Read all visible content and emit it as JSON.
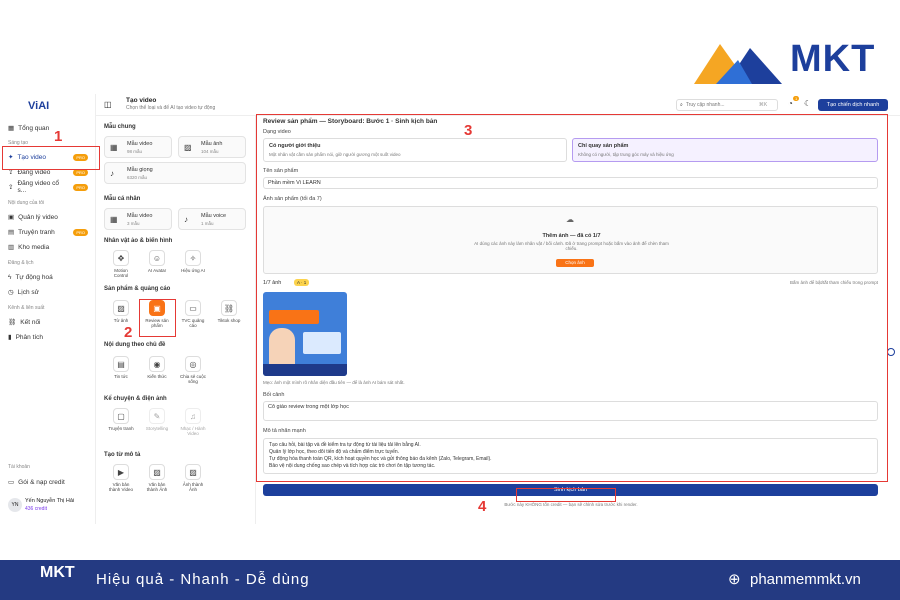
{
  "brand": {
    "name": "MKT"
  },
  "sidebar": {
    "logo": "ViAI",
    "items": [
      {
        "label": "Tổng quan"
      },
      {
        "label": "Tạo video",
        "badge": "PRO"
      },
      {
        "label": "Đăng video",
        "badge": "PRO"
      },
      {
        "label": "Đăng video cổ s...",
        "badge": "PRO"
      },
      {
        "label": "Quản lý video"
      },
      {
        "label": "Truyện tranh",
        "badge": "PRO"
      },
      {
        "label": "Kho media"
      },
      {
        "label": "Tự động hoá"
      },
      {
        "label": "Lịch sử"
      },
      {
        "label": "Kết nối"
      },
      {
        "label": "Phân tích"
      },
      {
        "label": "Gói & nạp credit"
      }
    ],
    "sections": [
      "Sáng tạo",
      "Nội dung của tôi",
      "Đăng & lịch",
      "Kênh & liên suất",
      "Tài khoản"
    ],
    "user": {
      "initials": "YN",
      "name": "Yến Nguyễn Thị Hải",
      "credit": "436 credit"
    }
  },
  "topbar": {
    "title": "Tạo video",
    "subtitle": "Chọn thể loại và để AI tạo video tự động",
    "search_placeholder": "Truy cập nhanh...",
    "search_kbd": "⌘K",
    "notif_count": "1",
    "cta": "Tạo chiến dịch nhanh"
  },
  "templates": {
    "common_title": "Mẫu chung",
    "video": {
      "label": "Mẫu video",
      "count": "98 mẫu"
    },
    "image": {
      "label": "Mẫu ảnh",
      "count": "104 mẫu"
    },
    "voice": {
      "label": "Mẫu giọng",
      "count": "6320 mẫu"
    },
    "personal_title": "Mẫu cá nhân",
    "pvideo": {
      "label": "Mẫu video",
      "count": "3 mẫu"
    },
    "pvoice": {
      "label": "Mẫu voice",
      "count": "1 mẫu"
    },
    "char_title": "Nhân vật ảo & biến hình",
    "char_items": [
      "Motion Control",
      "AI Avatar",
      "Hiệu ứng AI"
    ],
    "product_title": "Sản phẩm & quảng cáo",
    "product_items": [
      "Từ ảnh",
      "Review sản phẩm",
      "TVC quảng cáo",
      "Tiktok shop"
    ],
    "topic_title": "Nội dung theo chủ đề",
    "topic_items": [
      "Tin tức",
      "Kiến thức",
      "Chia sẻ cuộc sống"
    ],
    "story_title": "Kể chuyện & điện ảnh",
    "story_items": [
      "Truyện tranh",
      "Storytelling",
      "Nhạc / Hành Video"
    ],
    "text_title": "Tạo từ mô tả",
    "text_items": [
      "Văn bản thành Video",
      "Văn bản thành Ảnh",
      "Ảnh thành Ảnh"
    ]
  },
  "form": {
    "header": "Review sản phẩm — Storyboard: Bước 1 · Sinh kịch bản",
    "type_label": "Dạng video",
    "opt1_title": "Có người giới thiệu",
    "opt1_desc": "Một nhân vật cầm sản phẩm nói, giữ người gương một suốt video",
    "opt2_title": "Chỉ quay sản phẩm",
    "opt2_desc": "Không có người, tập trung góc máy và hiệu ứng",
    "name_label": "Tên sản phẩm",
    "name_value": "Phần mềm Vi LEARN",
    "img_label": "Ảnh sản phẩm (tối đa 7)",
    "upload_title": "Thêm ảnh — đã có 1/7",
    "upload_desc": "AI dùng các ảnh này làm nhân vật / bối cảnh. Đã ở trang prompt hoặc bấm vào ảnh để chèn tham chiếu.",
    "upload_btn": "Chọn ảnh",
    "img_count": "1/7 ảnh",
    "img_tag": "A · 1",
    "img_hint": "Bấm ảnh để bật/tắt tham chiếu trong prompt",
    "img_caption": "Mẹo: ảnh một mình rõ nhân diện đầu tiên — để là ảnh AI bám sát nhất.",
    "bg_label": "Bối cảnh",
    "bg_value": "Cô giáo review trong một lớp học",
    "desc_label": "Mô tả nhãn mạnh",
    "desc_lines": [
      "Tạo câu hỏi, bài tập và đề kiểm tra tự động từ tài liệu tải lên bằng AI.",
      "Quản lý lớp học, theo dõi tiến độ và chấm điểm trực tuyến.",
      "Tự động hóa thanh toán QR, kích hoạt quyền học và gửi thông báo đa kênh (Zalo, Telegram, Email).",
      "Bảo vệ nội dung chống sao chép và tích hợp các trò chơi ôn tập tương tác."
    ],
    "submit": "Sinh kịch bản",
    "note": "Bước này KHÔNG tốn credit — bạn sẽ chỉnh sửa trước khi render."
  },
  "annotations": [
    "1",
    "2",
    "3",
    "4"
  ],
  "footer": {
    "logo": "MKT",
    "slogan": "Hiệu quả - Nhanh - Dễ dùng",
    "site": "phanmemmkt.vn"
  },
  "colors": {
    "brand_blue": "#1d3f9c",
    "brand_orange": "#f5a623",
    "footer_bg": "#243a82",
    "annotation_red": "#e53935",
    "accent_orange": "#f97316"
  }
}
